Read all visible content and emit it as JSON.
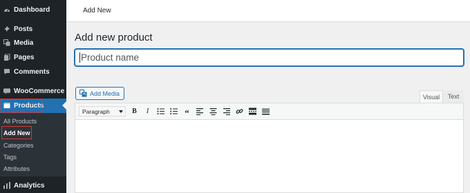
{
  "sidebar": {
    "items": [
      {
        "label": "Dashboard",
        "icon": "dashboard-icon"
      },
      {
        "label": "Posts",
        "icon": "pin-icon"
      },
      {
        "label": "Media",
        "icon": "media-icon"
      },
      {
        "label": "Pages",
        "icon": "pages-icon"
      },
      {
        "label": "Comments",
        "icon": "comments-icon"
      },
      {
        "label": "WooCommerce",
        "icon": "woocommerce-icon"
      },
      {
        "label": "Products",
        "icon": "products-icon"
      },
      {
        "label": "Analytics",
        "icon": "analytics-icon"
      }
    ],
    "submenu": [
      "All Products",
      "Add New",
      "Categories",
      "Tags",
      "Attributes"
    ]
  },
  "topbar": {
    "title": "Add New"
  },
  "main": {
    "heading": "Add new product",
    "title_placeholder": "Product name",
    "add_media_label": "Add Media",
    "tabs": [
      "Visual",
      "Text"
    ],
    "format_select": "Paragraph"
  },
  "colors": {
    "sidebar_bg": "#1d2327",
    "accent": "#2271b1",
    "highlight_box": "#d63638"
  }
}
